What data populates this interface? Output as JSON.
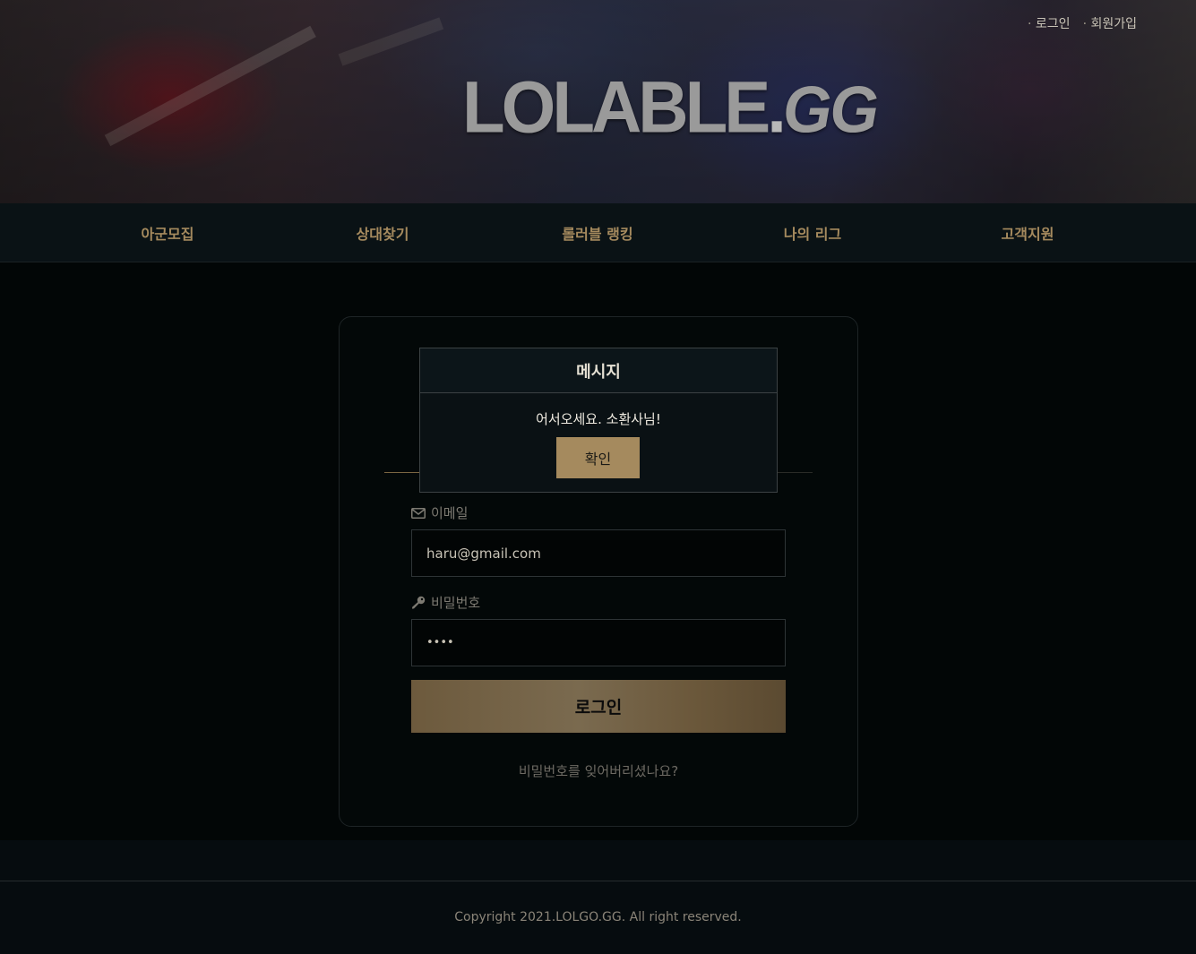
{
  "header": {
    "logo_main": "LOLABLE",
    "logo_dot": ".",
    "logo_suffix": "GG",
    "top_links": {
      "login": "로그인",
      "signup": "회원가입"
    }
  },
  "nav": {
    "items": [
      {
        "label": "아군모집"
      },
      {
        "label": "상대찾기"
      },
      {
        "label": "롤러블 랭킹"
      },
      {
        "label": "나의 리그"
      },
      {
        "label": "고객지원"
      }
    ]
  },
  "login_form": {
    "email_label": "이메일",
    "email_value": "haru@gmail.com",
    "password_label": "비밀번호",
    "password_value": "••••",
    "submit_label": "로그인",
    "forgot_link": "비밀번호를 잊어버리셨나요?"
  },
  "modal": {
    "title": "메시지",
    "message": "어서오세요. 소환사님!",
    "ok_label": "확인"
  },
  "footer": {
    "copyright": "Copyright 2021.LOLGO.GG. All right reserved."
  },
  "colors": {
    "accent_gold": "#a58a5e",
    "background": "#020606",
    "nav_background": "#0a1215"
  },
  "icons": {
    "email": "envelope-icon",
    "password": "key-icon"
  }
}
